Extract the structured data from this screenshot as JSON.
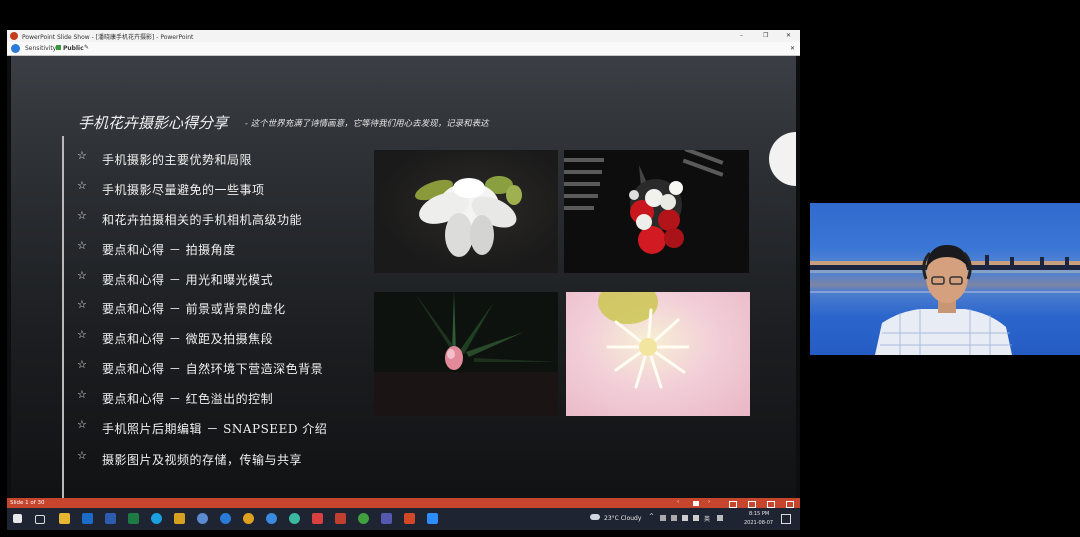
{
  "window": {
    "title": "PowerPoint Slide Show - [潘晓康手机花卉摄影] - PowerPoint",
    "controls": {
      "minimize": "–",
      "restore": "❐",
      "close": "✕"
    }
  },
  "sensitivity": {
    "label": "Sensitivity:",
    "value": "Public",
    "close": "✕"
  },
  "slide": {
    "title": "手机花卉摄影心得分享",
    "subtitle": "- 这个世界充满了诗情画意，它等待我们用心去发现，记录和表达",
    "bullet_symbol": "☆",
    "items": [
      "手机摄影的主要优势和局限",
      "手机摄影尽量避免的一些事项",
      "和花卉拍摄相关的手机相机高级功能",
      "要点和心得 － 拍摄角度",
      "要点和心得 － 用光和曝光模式",
      "要点和心得 － 前景或背景的虚化",
      "要点和心得 － 微距及拍摄焦段",
      "要点和心得 － 自然环境下营造深色背景",
      "要点和心得 － 红色溢出的控制",
      "手机照片后期编辑 － SNAPSEED 介绍",
      "摄影图片及视频的存储，传输与共享"
    ]
  },
  "status": {
    "slide_indicator": "Slide 1 of 30"
  },
  "taskbar": {
    "weather": "23°C  Cloudy",
    "time": "8:15 PM",
    "date": "2021-08-07",
    "lang": "英"
  },
  "colors": {
    "accent": "#c5452d",
    "taskbar": "#1e2432"
  }
}
